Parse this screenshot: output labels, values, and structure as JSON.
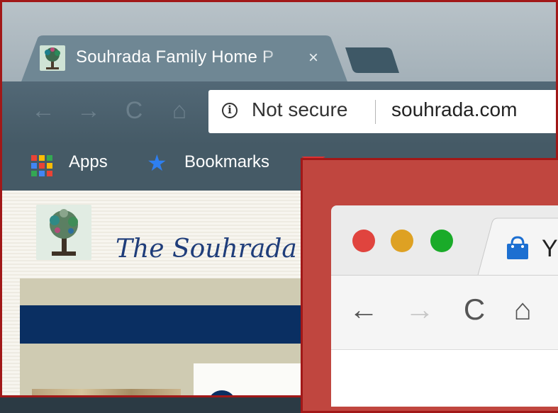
{
  "back_browser": {
    "tab": {
      "title": "Souhrada Family Home P",
      "close_glyph": "×",
      "favicon": "tree-icon"
    },
    "toolbar": {
      "back_glyph": "←",
      "forward_glyph": "→",
      "reload_glyph": "C",
      "home_glyph": "⌂"
    },
    "omnibox": {
      "security_label": "Not secure",
      "info_glyph": "i",
      "url": "souhrada.com"
    },
    "bookmarks": {
      "apps_label": "Apps",
      "bookmarks_label": "Bookmarks",
      "star_glyph": "★"
    }
  },
  "page": {
    "title": "The Souhrada F",
    "colors": {
      "navy": "#0a2f62",
      "beige": "#cfcbb2"
    }
  },
  "front_browser": {
    "tab": {
      "title": "Y",
      "favicon": "shopping-bag-icon"
    },
    "toolbar": {
      "back_glyph": "←",
      "forward_glyph": "→",
      "reload_glyph": "C",
      "home_glyph": "⌂"
    },
    "traffic_lights": {
      "close": "#e0443e",
      "minimize": "#dea123",
      "zoom": "#1aab29"
    }
  }
}
